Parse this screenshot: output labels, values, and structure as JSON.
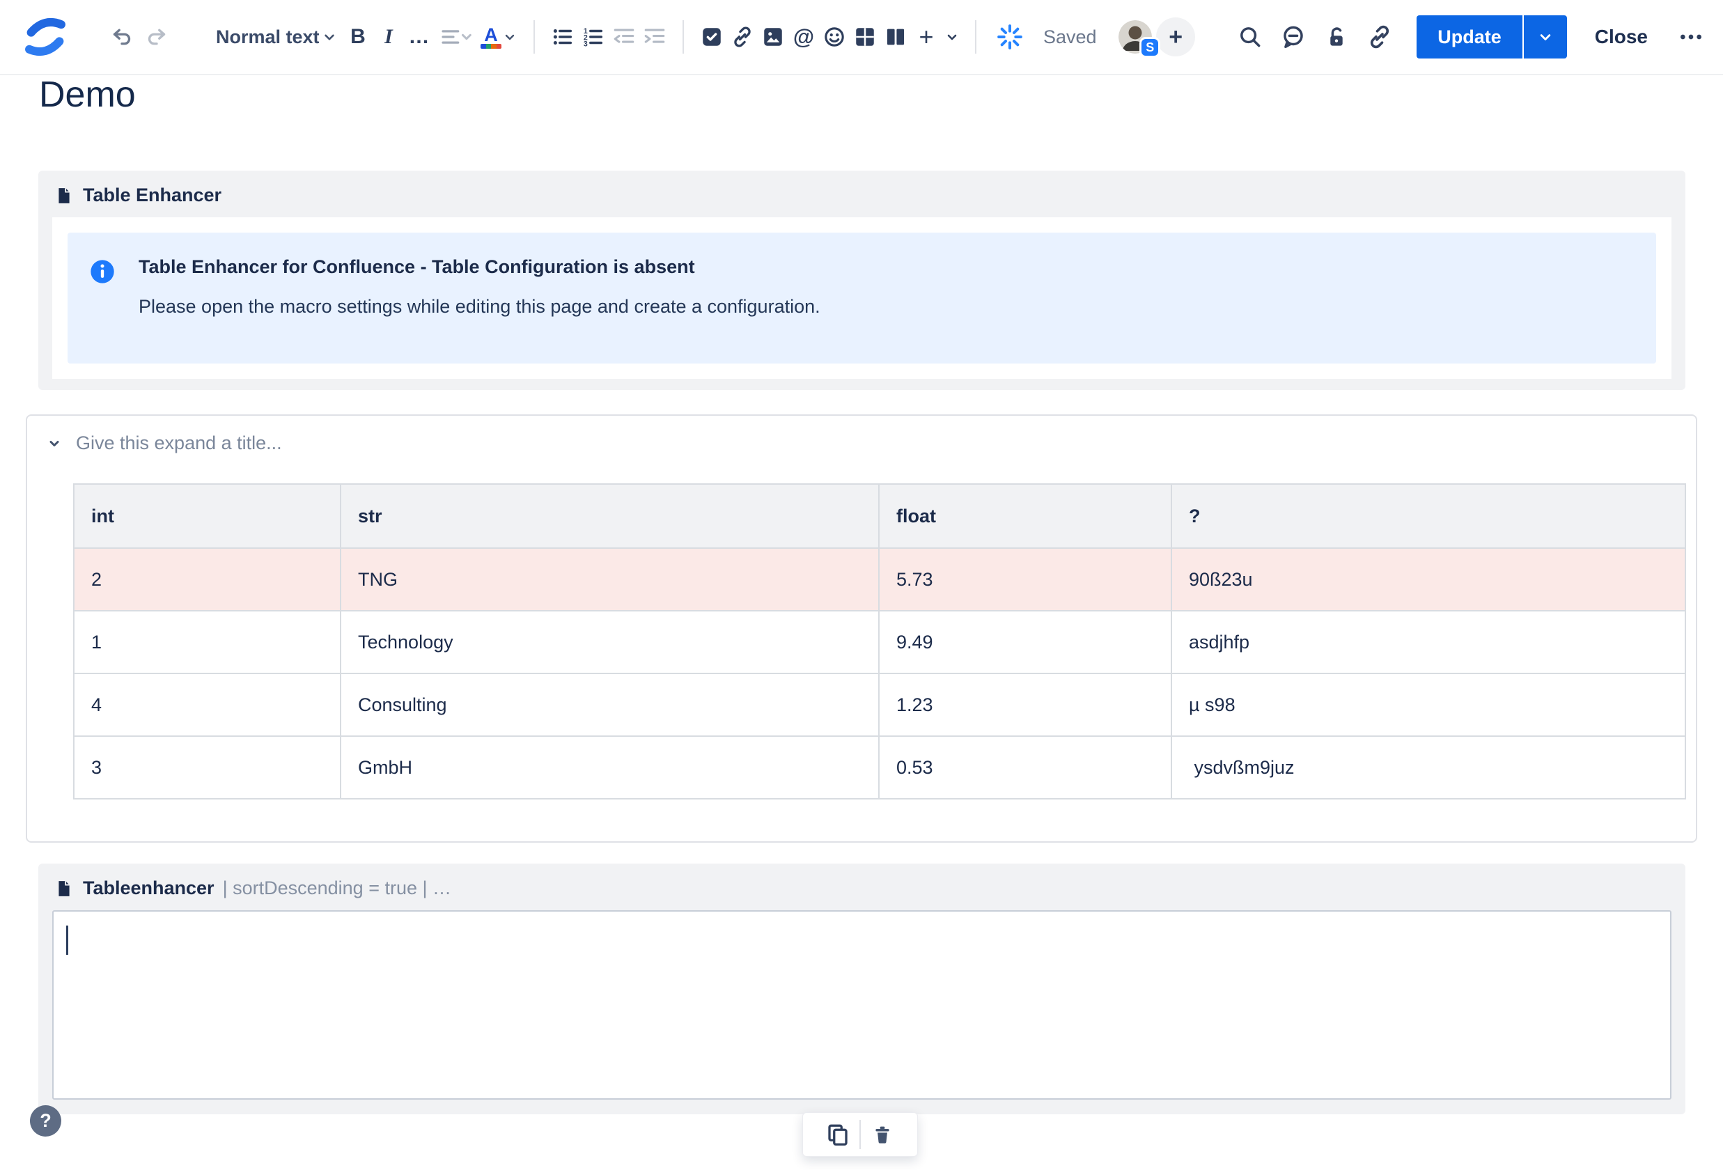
{
  "toolbar": {
    "text_style": "Normal text",
    "bold_label": "B",
    "italic_label": "I",
    "more_format_label": "…",
    "plus_label": "+",
    "save_status": "Saved",
    "avatar_badge": "S",
    "update_label": "Update",
    "close_label": "Close"
  },
  "page": {
    "title": "Demo"
  },
  "macro1": {
    "name": "Table Enhancer",
    "info": {
      "title": "Table Enhancer for Confluence - Table Configuration is absent",
      "body": "Please open the macro settings while editing this page and create a configuration."
    }
  },
  "expand": {
    "title_placeholder": "Give this expand a title..."
  },
  "table": {
    "headers": [
      "int",
      "str",
      "float",
      "?"
    ],
    "rows": [
      {
        "cells": [
          "2",
          "TNG",
          "5.73",
          "90ß23u"
        ],
        "highlight": true
      },
      {
        "cells": [
          "1",
          "Technology",
          "9.49",
          "asdjhfp"
        ],
        "highlight": false
      },
      {
        "cells": [
          "4",
          "Consulting",
          "1.23",
          "µ s98"
        ],
        "highlight": false
      },
      {
        "cells": [
          "3",
          "GmbH",
          "0.53",
          " ysdvßm9juz"
        ],
        "highlight": false
      }
    ]
  },
  "macro2": {
    "name": "Tableenhancer",
    "params": "| sortDescending = true | …"
  },
  "help_label": "?",
  "colors": {
    "accent-blue": "#0C66E4",
    "info-bg": "#E9F2FF",
    "info-icon": "#1D7AFC",
    "row-pink": "#FBE9E7",
    "panel-bg": "#F1F2F4",
    "text-dark": "#172B4D",
    "text-gray": "#7A869A"
  }
}
